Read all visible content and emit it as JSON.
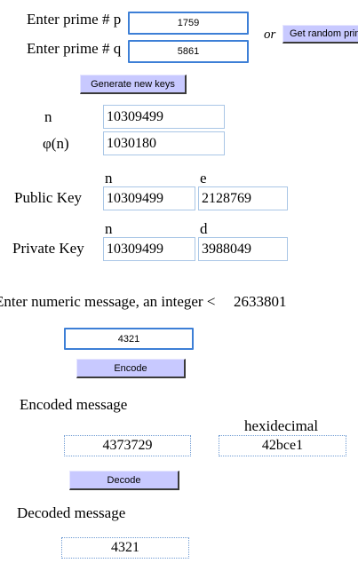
{
  "primes": {
    "p_label": "Enter prime # p",
    "p_value": "1759",
    "q_label": "Enter prime # q",
    "q_value": "5861",
    "or_text": "or",
    "random_button": "Get random primes"
  },
  "generate_button": "Generate new keys",
  "modulus": {
    "n_label": "n",
    "n_value": "10309499",
    "phi_label": "φ(n)",
    "phi_value": "1030180"
  },
  "public_key": {
    "label": "Public Key",
    "n_header": "n",
    "e_header": "e",
    "n_value": "10309499",
    "e_value": "2128769"
  },
  "private_key": {
    "label": "Private Key",
    "n_header": "n",
    "d_header": "d",
    "n_value": "10309499",
    "d_value": "3988049"
  },
  "message": {
    "prompt": "Enter numeric message, an integer <",
    "limit": "2633801",
    "value": "4321",
    "encode_button": "Encode"
  },
  "encoded": {
    "label": "Encoded message",
    "hex_header": "hexidecimal",
    "value": "4373729",
    "hex_value": "42bce1",
    "decode_button": "Decode"
  },
  "decoded": {
    "label": "Decoded message",
    "value": "4321"
  }
}
